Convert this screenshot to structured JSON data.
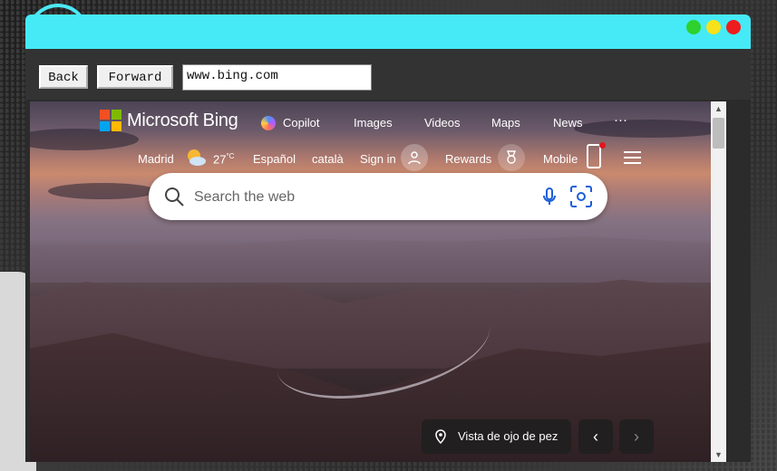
{
  "browser": {
    "back_label": "Back",
    "forward_label": "Forward",
    "url": "www.bing.com"
  },
  "window_controls": {
    "colors": {
      "minimize": "#2ed12e",
      "maximize": "#f5e21a",
      "close": "#ee1c1c"
    }
  },
  "bing": {
    "brand": "Microsoft Bing",
    "nav": [
      "Copilot",
      "Images",
      "Videos",
      "Maps",
      "News",
      "···"
    ],
    "location": "Madrid",
    "temperature": "27",
    "temp_unit": "°C",
    "languages": [
      "Español",
      "català"
    ],
    "sign_in": "Sign in",
    "rewards": "Rewards",
    "mobile": "Mobile",
    "search_placeholder": "Search the web",
    "image_caption": "Vista de ojo de pez",
    "prev_arrow": "‹",
    "next_arrow": "›"
  },
  "icons": [
    "microsoft-logo-icon",
    "copilot-icon",
    "weather-icon",
    "avatar-icon",
    "rewards-icon",
    "mobile-icon",
    "menu-icon",
    "search-icon",
    "mic-icon",
    "visual-search-icon",
    "location-pin-icon"
  ]
}
